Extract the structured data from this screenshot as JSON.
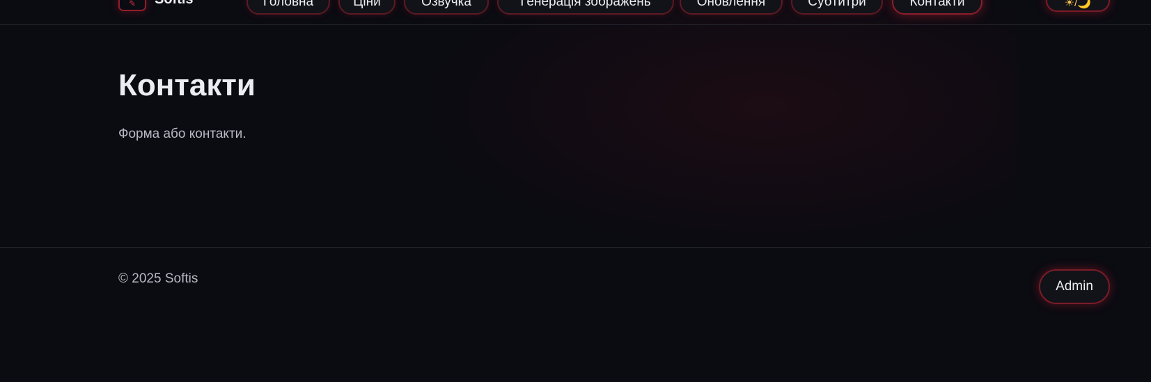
{
  "header": {
    "brand": "Softis",
    "logo_icon": "rocket-icon",
    "nav": [
      {
        "label": "Головна",
        "active": false
      },
      {
        "label": "Ціни",
        "active": false
      },
      {
        "label": "Озвучка",
        "active": false
      },
      {
        "label": "Генерація зображень",
        "active": false
      },
      {
        "label": "Оновлення",
        "active": false
      },
      {
        "label": "Субтитри",
        "active": false
      },
      {
        "label": "Контакти",
        "active": true
      }
    ],
    "theme_toggle": {
      "label": "☀/🌙",
      "icon": "sun-moon-icon"
    }
  },
  "main": {
    "title": "Контакти",
    "subtitle": "Форма або контакти."
  },
  "footer": {
    "copyright": "© 2025 Softis",
    "admin_label": "Admin"
  },
  "colors": {
    "background": "#0b0b12",
    "accent": "#8a1f2c",
    "text": "#ececf2",
    "muted": "#b9b9c4"
  }
}
